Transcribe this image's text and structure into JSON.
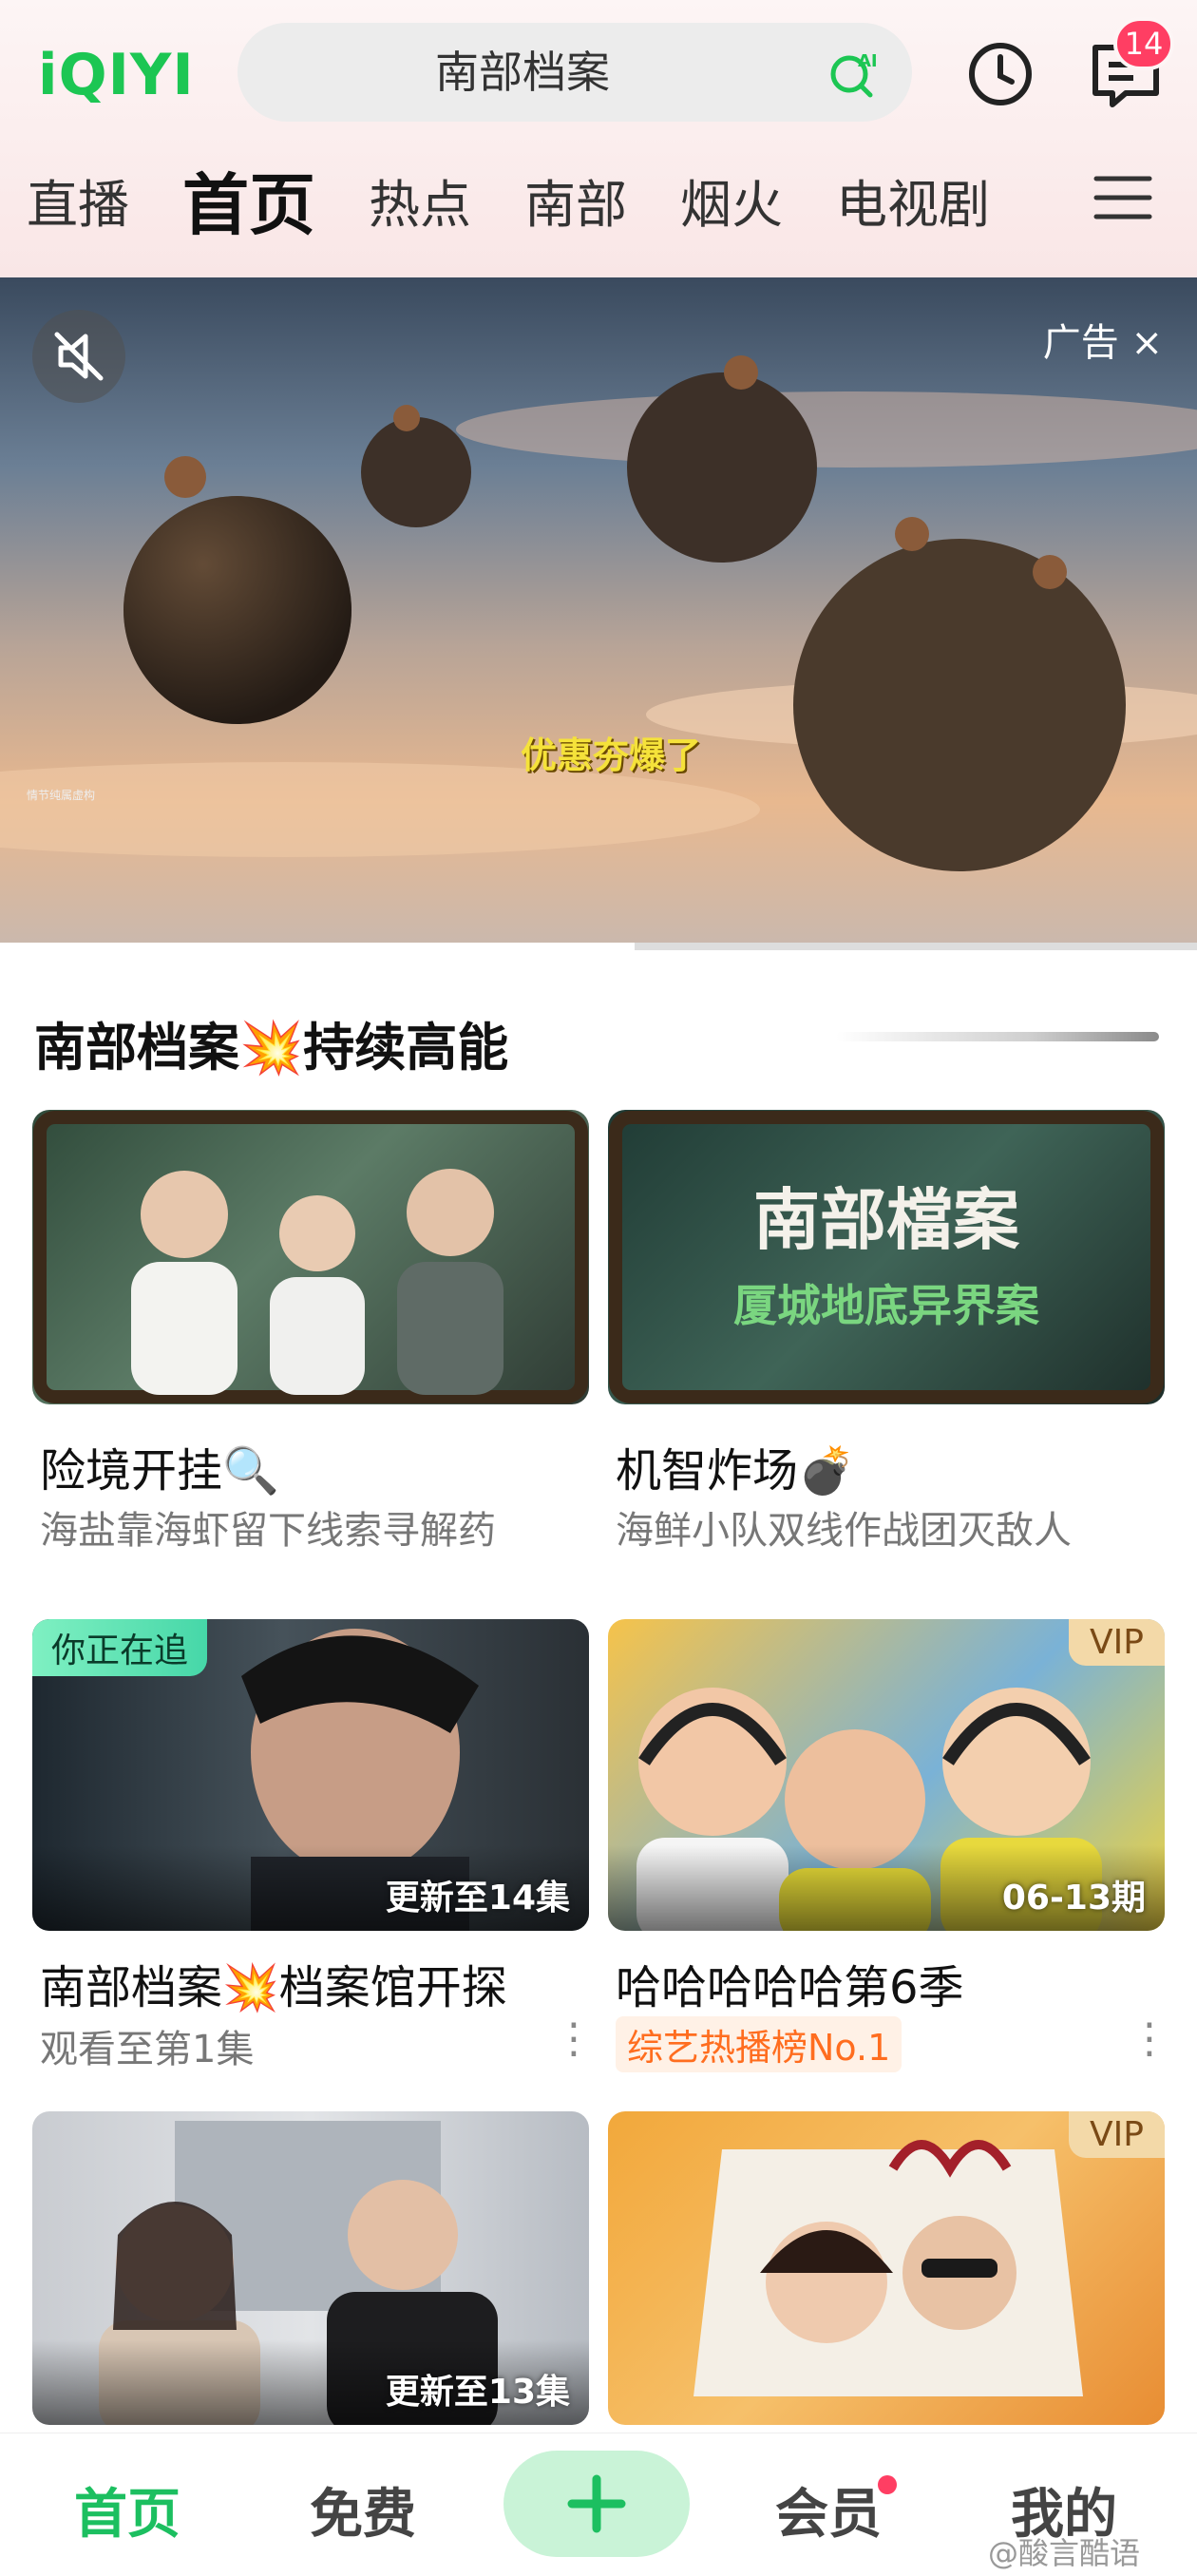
{
  "header": {
    "logo": "iQIYI",
    "search_text": "南部档案",
    "message_badge": "14",
    "tabs": [
      "直播",
      "首页",
      "热点",
      "南部",
      "烟火",
      "电视剧"
    ],
    "active_tab": "首页"
  },
  "banner": {
    "ad_label": "广告 ×",
    "caption": "优惠夯爆了",
    "small_text": "情节纯属虚构",
    "progress_fraction": 0.53
  },
  "section": {
    "title": "南部档案💥持续高能"
  },
  "cards": [
    {
      "title": "险境开挂🔍",
      "subtitle": "海盐靠海虾留下线索寻解药"
    },
    {
      "title": "机智炸场💣",
      "subtitle": "海鲜小队双线作战团灭敌人",
      "poster_title": "南部檔案",
      "poster_subtitle": "厦城地底异界案"
    },
    {
      "title": "南部档案💥档案馆开探",
      "subtitle": "观看至第1集",
      "badge": "你正在追",
      "episode": "更新至14集"
    },
    {
      "title": "哈哈哈哈哈第6季",
      "tag": "综艺热播榜No.1",
      "badge": "VIP",
      "episode": "06-13期"
    },
    {
      "episode": "更新至13集"
    },
    {
      "badge": "VIP"
    }
  ],
  "bottom_nav": {
    "items": [
      "首页",
      "免费",
      "会员",
      "我的"
    ],
    "active": "首页",
    "plus_label": "+"
  },
  "watermark": "@酸言酷语",
  "colors": {
    "brand_green": "#1cc653",
    "badge_red": "#ff3e63",
    "tag_orange": "#ff6d1f"
  }
}
